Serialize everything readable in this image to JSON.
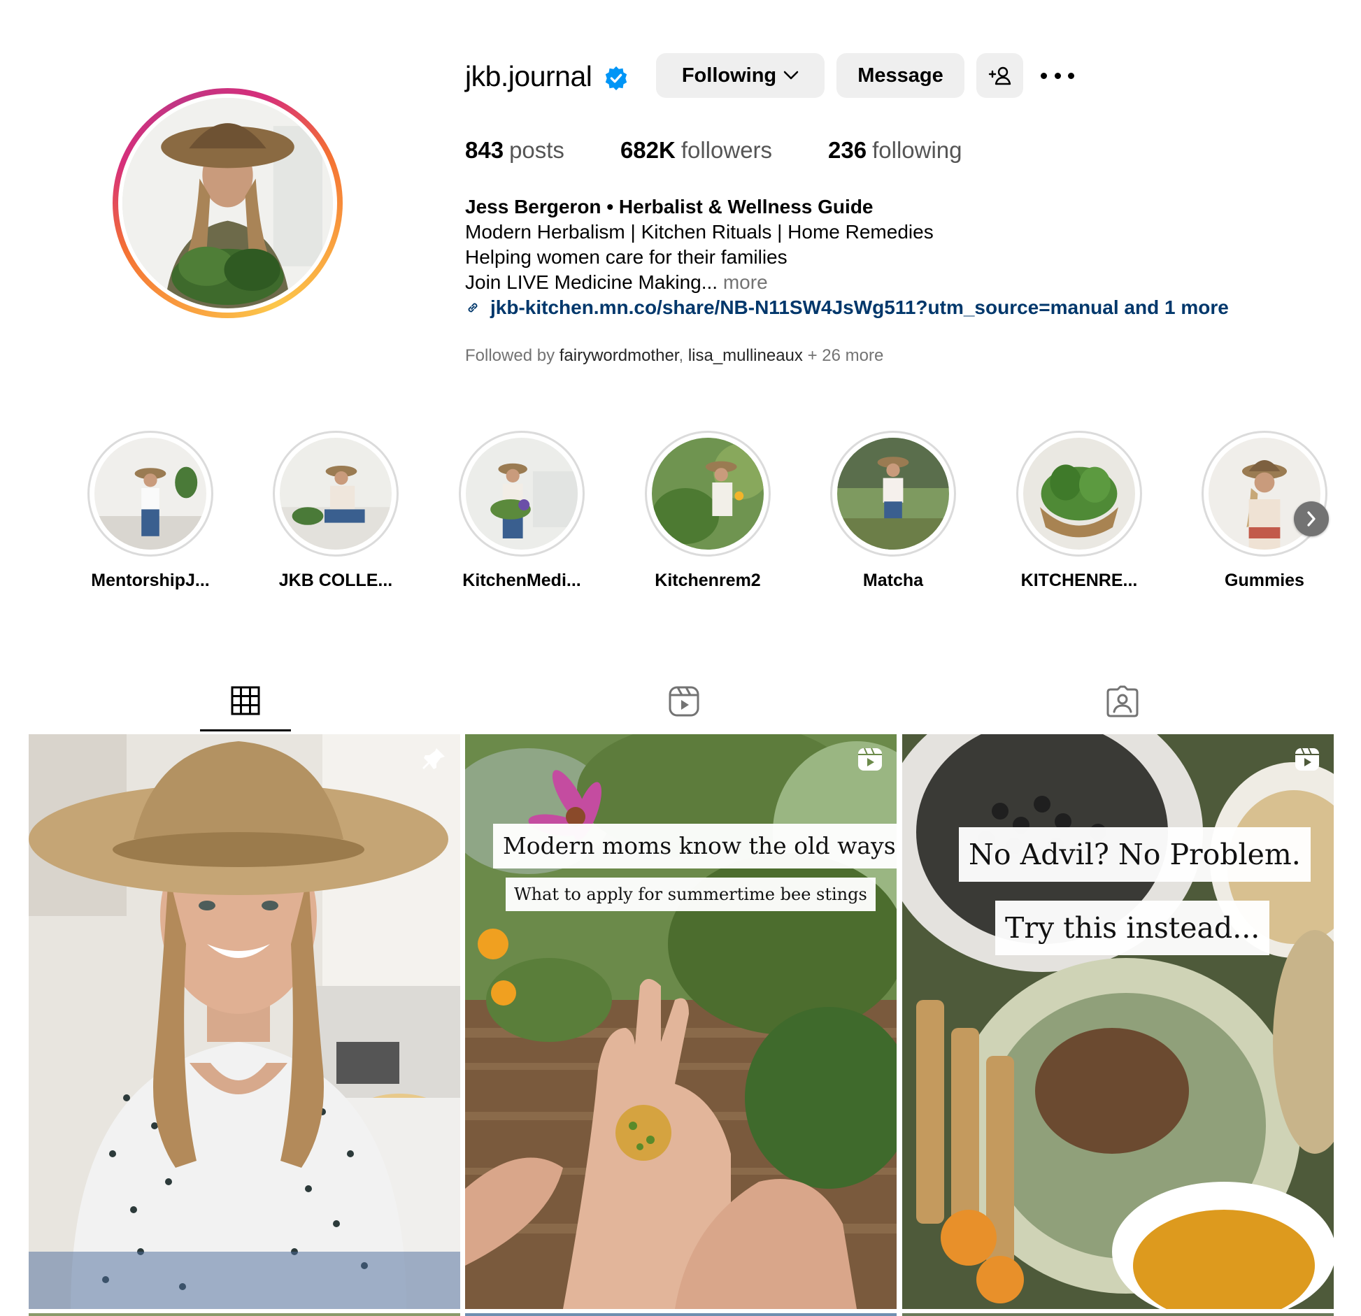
{
  "profile": {
    "username": "jkb.journal",
    "verified": true,
    "buttons": {
      "following": "Following",
      "message": "Message"
    },
    "stats": [
      {
        "value": "843",
        "label": "posts"
      },
      {
        "value": "682K",
        "label": "followers"
      },
      {
        "value": "236",
        "label": "following"
      }
    ],
    "bio": {
      "name": "Jess Bergeron • Herbalist & Wellness Guide",
      "lines": [
        "Modern Herbalism | Kitchen Rituals | Home Remedies",
        "Helping women care for their families"
      ],
      "truncated_line": "Join LIVE Medicine Making...",
      "more": "more",
      "link": "jkb-kitchen.mn.co/share/NB-N11SW4JsWg511?utm_source=manual and 1 more"
    },
    "followed_by": {
      "prefix": "Followed by",
      "user1": "fairywordmother",
      "separator": ",",
      "user2": "lisa_mullineaux",
      "suffix": "+ 26 more"
    }
  },
  "highlights": [
    {
      "label": "MentorshipJ..."
    },
    {
      "label": "JKB COLLE..."
    },
    {
      "label": "KitchenMedi..."
    },
    {
      "label": "Kitchenrem2"
    },
    {
      "label": "Matcha"
    },
    {
      "label": "KITCHENRE..."
    },
    {
      "label": "Gummies"
    }
  ],
  "tabs": [
    {
      "name": "posts",
      "icon": "grid-icon",
      "active": true
    },
    {
      "name": "reels",
      "icon": "reels-icon",
      "active": false
    },
    {
      "name": "tagged",
      "icon": "tagged-icon",
      "active": false
    }
  ],
  "posts": [
    {
      "icon": "pin-icon",
      "captions": []
    },
    {
      "icon": "reel-icon",
      "captions": [
        "Modern moms know the old ways",
        "What to apply for summertime bee stings"
      ]
    },
    {
      "icon": "reel-icon",
      "captions": [
        "No Advil? No Problem.",
        "Try this instead..."
      ]
    }
  ],
  "colors": {
    "link": "#00376b",
    "secondary_text": "#737373",
    "button_bg": "#efefef",
    "verified": "#0095f6"
  }
}
